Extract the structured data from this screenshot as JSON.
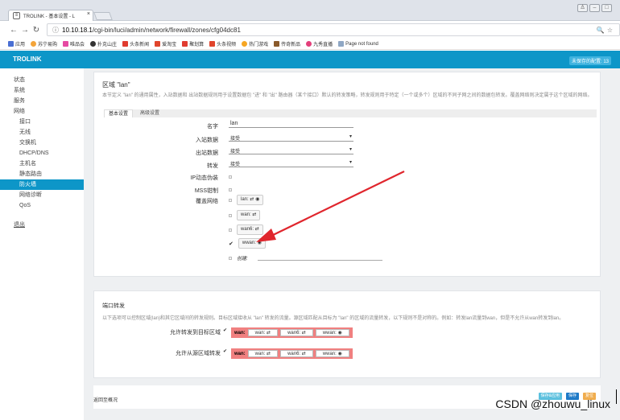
{
  "browser": {
    "tab_title": "TROLINK - 基本设置 - L",
    "url_host": "10.10.18.1",
    "url_path": "/cgi-bin/luci/admin/network/firewall/zones/cfg04dc81",
    "bookmarks": [
      "应用",
      "苏宁易购",
      "唯品会",
      "扑克山庄",
      "头条新闻",
      "爱淘宝",
      "聚划算",
      "头条视频",
      "热门游戏",
      "传奇新品",
      "九秀直播",
      "Page not found"
    ]
  },
  "header": {
    "brand": "TROLINK",
    "unsaved": "未保存的配置: 13"
  },
  "sidebar": {
    "items": [
      {
        "label": "状态",
        "sub": false
      },
      {
        "label": "系统",
        "sub": false
      },
      {
        "label": "服务",
        "sub": false
      },
      {
        "label": "网络",
        "sub": false
      },
      {
        "label": "接口",
        "sub": true
      },
      {
        "label": "无线",
        "sub": true
      },
      {
        "label": "交换机",
        "sub": true
      },
      {
        "label": "DHCP/DNS",
        "sub": true
      },
      {
        "label": "主机名",
        "sub": true
      },
      {
        "label": "静态路由",
        "sub": true
      },
      {
        "label": "防火墙",
        "sub": true,
        "active": true
      },
      {
        "label": "网络诊断",
        "sub": true
      },
      {
        "label": "QoS",
        "sub": true
      }
    ],
    "logout": "退出"
  },
  "zone": {
    "title": "区域 \"lan\"",
    "desc": "本节定义 \"lan\" 的通用属性，入站数据和 出站数据规则用于设置数据包 \"进\" 和 \"出\" 路由器（某个接口）默认的转发策略，转发规则用于特定（一个或多个）区域的不同子网之间的数据包转发。覆盖网络则决定属于这个区域的网络。",
    "tab_basic": "基本设置",
    "tab_advanced": "高级设置",
    "name_label": "名字",
    "name_value": "lan",
    "input_label": "入站数据",
    "input_value": "接受",
    "output_label": "出站数据",
    "output_value": "接受",
    "forward_label": "转发",
    "forward_value": "接受",
    "masq_label": "IP动态伪装",
    "mss_label": "MSS钳制",
    "covered_label": "覆盖网络",
    "networks": [
      {
        "name": "lan:",
        "checked": false
      },
      {
        "name": "wan:",
        "checked": false
      },
      {
        "name": "wan6:",
        "checked": false
      },
      {
        "name": "wwan:",
        "checked": true
      }
    ],
    "custom_label": "创建:"
  },
  "forwarding": {
    "title": "端口转发",
    "desc": "以下选项可以控制区域(lan)和其它区域间的转发规则。目标区域接收从 \"lan\" 转发的流量。源区域匹配从目标为 \"lan\" 的区域的流量转发，以下规则不是对称的。例如：转发lan流量到wan，但是不允许从wan转发到lan。",
    "allow_to_label": "允许转发到目标区域",
    "allow_from_label": "允许从源区域转发",
    "zone_bold": "wan:",
    "zones": [
      "wan:",
      "wan6:",
      "wwan:"
    ]
  },
  "footer": {
    "back": "返回至概况",
    "save_apply": "保存&应用",
    "save": "保存",
    "reset": "复位"
  },
  "watermark": "CSDN @zhouwu_linux",
  "colors": {
    "accent": "#0d96c8",
    "zone_red": "#f08080",
    "arrow_red": "#e0262d"
  }
}
